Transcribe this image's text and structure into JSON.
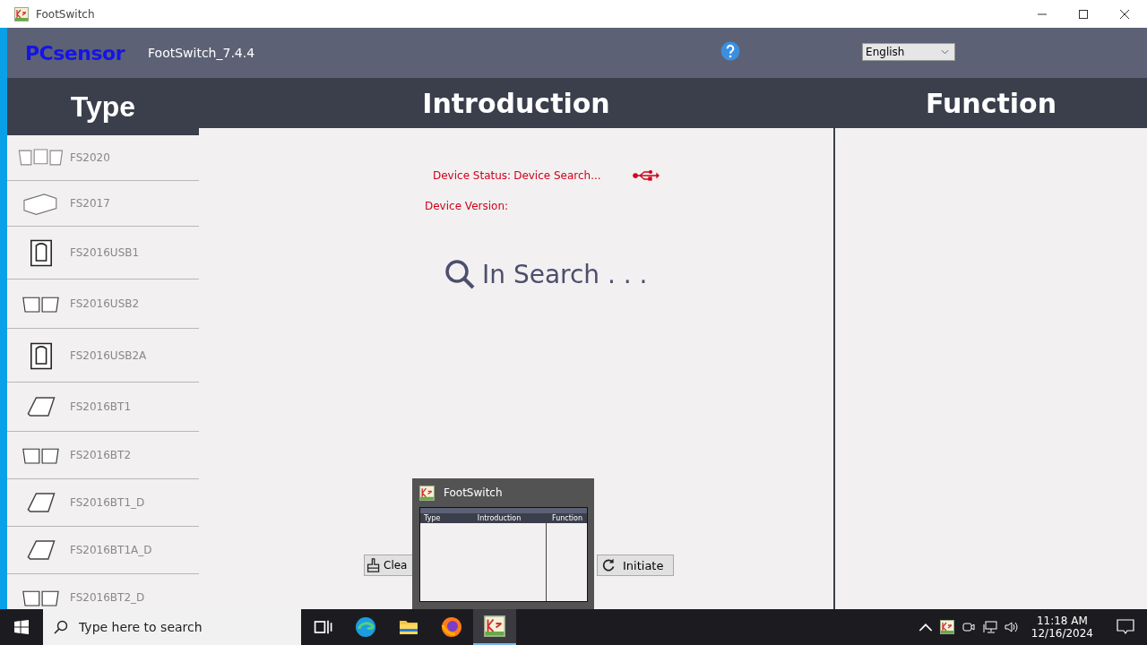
{
  "window": {
    "title": "FootSwitch",
    "logo": "PCsensor",
    "app_version": "FootSwitch_7.4.4",
    "language": "English"
  },
  "panels": {
    "type_header": "Type",
    "introduction_header": "Introduction",
    "function_header": "Function"
  },
  "device_types": [
    {
      "name": "FS2020"
    },
    {
      "name": "FS2017"
    },
    {
      "name": "FS2016USB1"
    },
    {
      "name": "FS2016USB2"
    },
    {
      "name": "FS2016USB2A"
    },
    {
      "name": "FS2016BT1"
    },
    {
      "name": "FS2016BT2"
    },
    {
      "name": "FS2016BT1_D"
    },
    {
      "name": "FS2016BT1A_D"
    },
    {
      "name": "FS2016BT2_D"
    }
  ],
  "device_status": {
    "label": "Device Status:",
    "value": "Device Search...",
    "version_label": "Device Version:"
  },
  "search_status": "In Search . . .",
  "buttons": [
    {
      "kind": "clear",
      "label": "Clea"
    },
    {
      "kind": "initiate",
      "label": "Initiate"
    }
  ],
  "taskbar_preview": {
    "title": "FootSwitch",
    "mini_headers": [
      "Type",
      "Introduction",
      "Function"
    ]
  },
  "taskbar": {
    "search_placeholder": "Type here to search",
    "time": "11:18 AM",
    "date": "12/16/2024",
    "apps": [
      {
        "kind": "task-view",
        "selected": false
      },
      {
        "kind": "edge",
        "selected": false
      },
      {
        "kind": "explorer",
        "selected": false
      },
      {
        "kind": "firefox",
        "selected": false
      },
      {
        "kind": "footswitch",
        "selected": true
      }
    ]
  }
}
